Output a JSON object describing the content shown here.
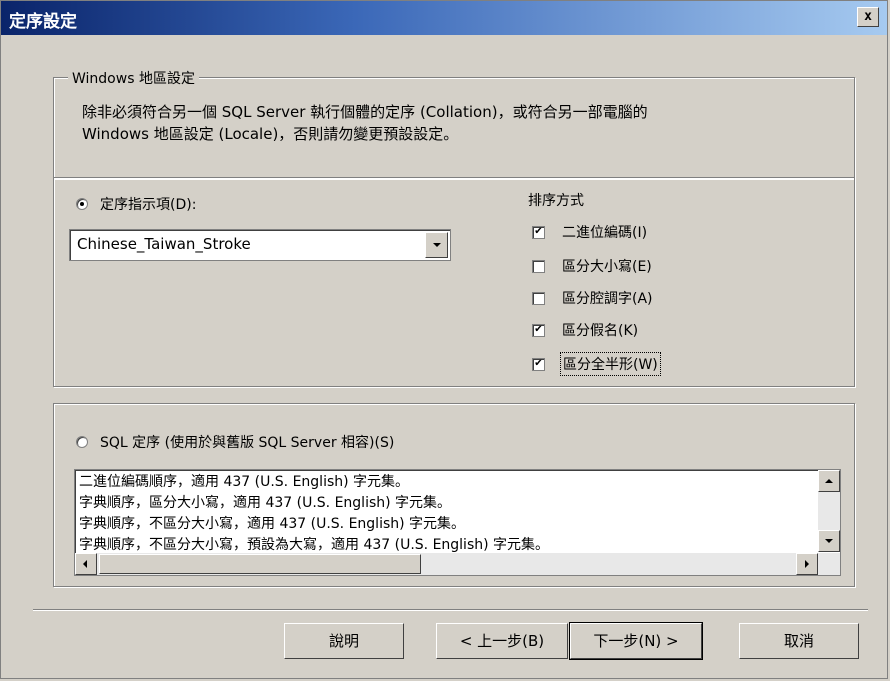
{
  "window": {
    "title": "定序設定",
    "close_label": "x"
  },
  "locale_group": {
    "title": "Windows 地區設定",
    "line1": "除非必須符合另一個 SQL Server 執行個體的定序 (Collation)，或符合另一部電腦的",
    "line2": "Windows 地區設定 (Locale)，否則請勿變更預設設定。"
  },
  "collation": {
    "radio_label": "定序指示項(D):",
    "selected": "Chinese_Taiwan_Stroke",
    "sort_title": "排序方式",
    "options": [
      {
        "label": "二進位編碼(I)",
        "checked": true
      },
      {
        "label": "區分大小寫(E)",
        "checked": false
      },
      {
        "label": "區分腔調字(A)",
        "checked": false
      },
      {
        "label": "區分假名(K)",
        "checked": true
      },
      {
        "label": "區分全半形(W)",
        "checked": true
      }
    ]
  },
  "sql_collation": {
    "radio_label": "SQL 定序 (使用於與舊版 SQL Server 相容)(S)",
    "items": [
      "二進位編碼順序，適用 437 (U.S. English) 字元集。",
      "字典順序，區分大小寫，適用 437 (U.S. English) 字元集。",
      "字典順序，不區分大小寫，適用 437 (U.S. English) 字元集。",
      "字典順序，不區分大小寫，預設為大寫，適用 437 (U.S. English) 字元集。"
    ]
  },
  "buttons": {
    "help": "說明",
    "back": "< 上一步(B)",
    "next": "下一步(N) >",
    "cancel": "取消"
  }
}
